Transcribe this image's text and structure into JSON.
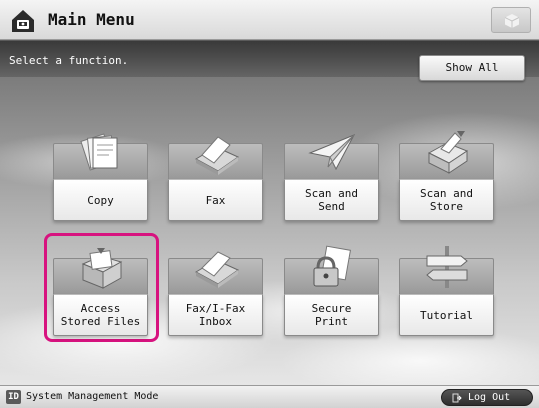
{
  "header": {
    "title": "Main Menu"
  },
  "subheader": {
    "instruction": "Select a function.",
    "show_all_label": "Show All"
  },
  "functions": [
    {
      "label": "Copy",
      "icon": "copy-icon"
    },
    {
      "label": "Fax",
      "icon": "fax-icon"
    },
    {
      "label": "Scan and\nSend",
      "icon": "scan-send-icon"
    },
    {
      "label": "Scan and\nStore",
      "icon": "scan-store-icon"
    },
    {
      "label": "Access\nStored Files",
      "icon": "stored-files-icon",
      "selected": true
    },
    {
      "label": "Fax/I-Fax\nInbox",
      "icon": "fax-inbox-icon"
    },
    {
      "label": "Secure\nPrint",
      "icon": "secure-print-icon"
    },
    {
      "label": "Tutorial",
      "icon": "tutorial-signpost-icon"
    }
  ],
  "footer": {
    "id_badge": "ID",
    "mode_label": "System Management Mode",
    "logout_label": "Log Out"
  },
  "colors": {
    "highlight": "#d7137f",
    "tile_icon_bg": "#a8a8a8",
    "logout_bg": "#3a3a3a"
  }
}
